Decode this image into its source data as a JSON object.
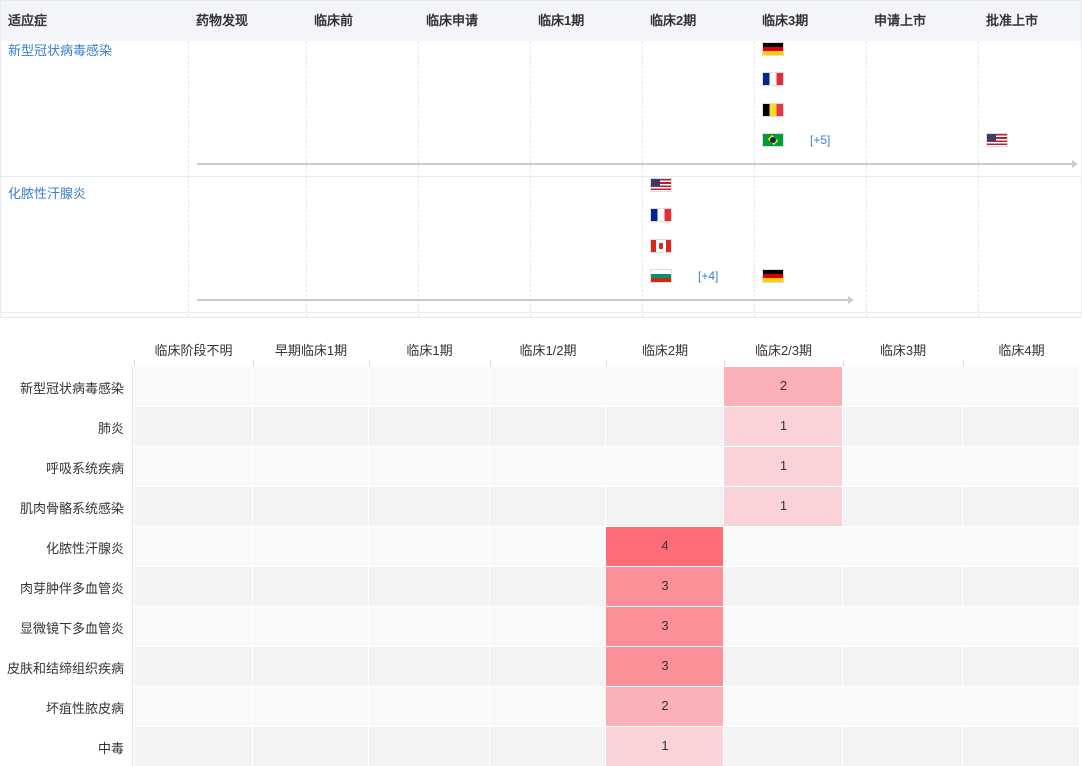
{
  "pipeline": {
    "headers": [
      "适应症",
      "药物发现",
      "临床前",
      "临床申请",
      "临床1期",
      "临床2期",
      "临床3期",
      "申请上市",
      "批准上市"
    ],
    "rows": [
      {
        "indication": "新型冠状病毒感染",
        "furthest_stage": "批准上市",
        "flags": [
          {
            "stage": "临床3期",
            "country": "germany-flag"
          },
          {
            "stage": "临床3期",
            "country": "france-flag"
          },
          {
            "stage": "临床3期",
            "country": "belgium-flag"
          },
          {
            "stage": "临床3期",
            "country": "brazil-flag"
          },
          {
            "stage": "批准上市",
            "country": "usa-flag"
          }
        ],
        "more": {
          "stage": "临床3期",
          "label": "[+5]"
        }
      },
      {
        "indication": "化脓性汗腺炎",
        "furthest_stage": "临床3期",
        "flags": [
          {
            "stage": "临床2期",
            "country": "usa-flag"
          },
          {
            "stage": "临床2期",
            "country": "france-flag"
          },
          {
            "stage": "临床2期",
            "country": "canada-flag"
          },
          {
            "stage": "临床2期",
            "country": "bulgaria-flag"
          },
          {
            "stage": "临床3期",
            "country": "germany-flag"
          }
        ],
        "more": {
          "stage": "临床2期",
          "label": "[+4]"
        }
      }
    ]
  },
  "chart_data": {
    "type": "heatmap",
    "x": [
      "临床阶段不明",
      "早期临床1期",
      "临床1期",
      "临床1/2期",
      "临床2期",
      "临床2/3期",
      "临床3期",
      "临床4期"
    ],
    "y": [
      "新型冠状病毒感染",
      "肺炎",
      "呼吸系统疾病",
      "肌肉骨骼系统感染",
      "化脓性汗腺炎",
      "肉芽肿伴多血管炎",
      "显微镜下多血管炎",
      "皮肤和结缔组织疾病",
      "坏疽性脓皮病",
      "中毒"
    ],
    "cells": [
      {
        "y": "新型冠状病毒感染",
        "x": "临床2/3期",
        "value": 2
      },
      {
        "y": "肺炎",
        "x": "临床2/3期",
        "value": 1
      },
      {
        "y": "呼吸系统疾病",
        "x": "临床2/3期",
        "value": 1
      },
      {
        "y": "肌肉骨骼系统感染",
        "x": "临床2/3期",
        "value": 1
      },
      {
        "y": "化脓性汗腺炎",
        "x": "临床2期",
        "value": 4
      },
      {
        "y": "肉芽肿伴多血管炎",
        "x": "临床2期",
        "value": 3
      },
      {
        "y": "显微镜下多血管炎",
        "x": "临床2期",
        "value": 3
      },
      {
        "y": "皮肤和结缔组织疾病",
        "x": "临床2期",
        "value": 3
      },
      {
        "y": "坏疽性脓皮病",
        "x": "临床2期",
        "value": 2
      },
      {
        "y": "中毒",
        "x": "临床2期",
        "value": 1
      }
    ],
    "color_scale": {
      "min": 1,
      "max": 4,
      "low_color": "#f9d3d7",
      "high_color": "#fe6d77"
    },
    "empty_colors": [
      "#fafafa",
      "#f3f3f3"
    ]
  }
}
